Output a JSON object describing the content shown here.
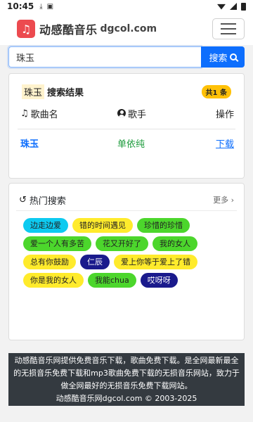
{
  "status_bar": {
    "time": "10:45"
  },
  "header": {
    "brand": "动感酷音乐",
    "domain": "dgcol.com"
  },
  "search": {
    "value": "珠玉",
    "button_label": "搜索"
  },
  "results": {
    "keyword": "珠玉",
    "title": "搜索结果",
    "count_badge": "共1 条",
    "columns": {
      "song": "歌曲名",
      "singer": "歌手",
      "action": "操作"
    },
    "rows": [
      {
        "song": "珠玉",
        "singer": "单依纯",
        "action": "下载"
      }
    ]
  },
  "hot_search": {
    "title": "热门搜索",
    "more_label": "更多",
    "tags": [
      {
        "label": "边走边爱",
        "color": "#0dcaf0",
        "text_color": "#222"
      },
      {
        "label": "错的时间遇见",
        "color": "#ffeb2c",
        "text_color": "#222"
      },
      {
        "label": "珍惜的珍惜",
        "color": "#4cd62c",
        "text_color": "#222"
      },
      {
        "label": "爱一个人有多苦",
        "color": "#4cd62c",
        "text_color": "#222"
      },
      {
        "label": "花又开好了",
        "color": "#4cd62c",
        "text_color": "#222"
      },
      {
        "label": "我的女人",
        "color": "#4cd62c",
        "text_color": "#222"
      },
      {
        "label": "总有你鼓励",
        "color": "#ffeb2c",
        "text_color": "#222"
      },
      {
        "label": "仁辰",
        "color": "#1a1a8c",
        "text_color": "#ffffff"
      },
      {
        "label": "爱上你等于爱上了错",
        "color": "#ffeb2c",
        "text_color": "#222"
      },
      {
        "label": "你是我的女人",
        "color": "#ffeb2c",
        "text_color": "#222"
      },
      {
        "label": "我能chua",
        "color": "#4cd62c",
        "text_color": "#222"
      },
      {
        "label": "哎呀呀",
        "color": "#1a1a8c",
        "text_color": "#ffffff"
      }
    ]
  },
  "footer": {
    "line1": "动感酷音乐网提供免费音乐下载，歌曲免费下载。是全网最新最全的无损音乐免费下载和mp3歌曲免费下载的无损音乐网站，致力于做全网最好的无损音乐免费下载网站。",
    "line2": "动感酷音乐网dgcol.com © 2003-2025"
  },
  "colors": {
    "primary": "#0d6efd",
    "brand_red": "#ec4a4f",
    "footer_bg": "#343a40"
  }
}
